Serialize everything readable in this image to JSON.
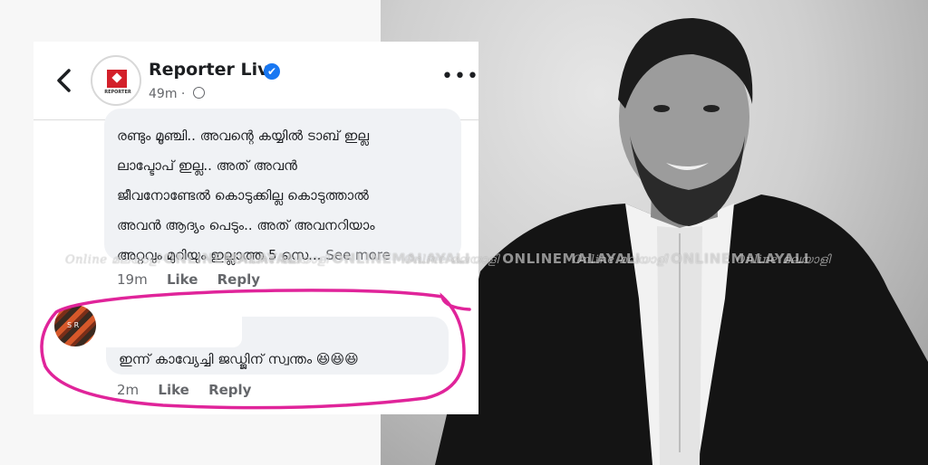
{
  "post": {
    "page_name": "Reporter Live",
    "verified_mark": "✔",
    "time": "49m · ",
    "logo_text": "REPORTER",
    "more_label": "•••"
  },
  "comments": [
    {
      "lines": [
        "രണ്ടും മൂഞ്ചി.. അവന്റെ കയ്യിൽ ടാബ് ഇല്ല",
        "ലാപ്ടോപ് ഇല്ല.. അത് അവൻ",
        "ജീവനോണ്ടേൽ കൊടുക്കില്ല കൊടുത്താൽ",
        "അവൻ ആദ്യം പെടും.. അത് അവനറിയാം",
        "അറ്റവും മുറിയും ഇല്ലാത്ത 5 സെ... "
      ],
      "see_more": "See more",
      "time": "19m",
      "like": "Like",
      "reply": "Reply"
    },
    {
      "avatar_text": "S R",
      "text": "ഇന്ന് കാവ്യേച്ചി ജഡ്ജിന് സ്വന്തം 😆😆😆",
      "time": "2m",
      "like": "Like",
      "reply": "Reply"
    }
  ],
  "watermark": {
    "script": "Online മലയാളി",
    "brand": "ONLINEMALAYALI"
  },
  "colors": {
    "highlight": "#e0249a",
    "verified": "#1877f2",
    "brand_red": "#d3202a"
  }
}
